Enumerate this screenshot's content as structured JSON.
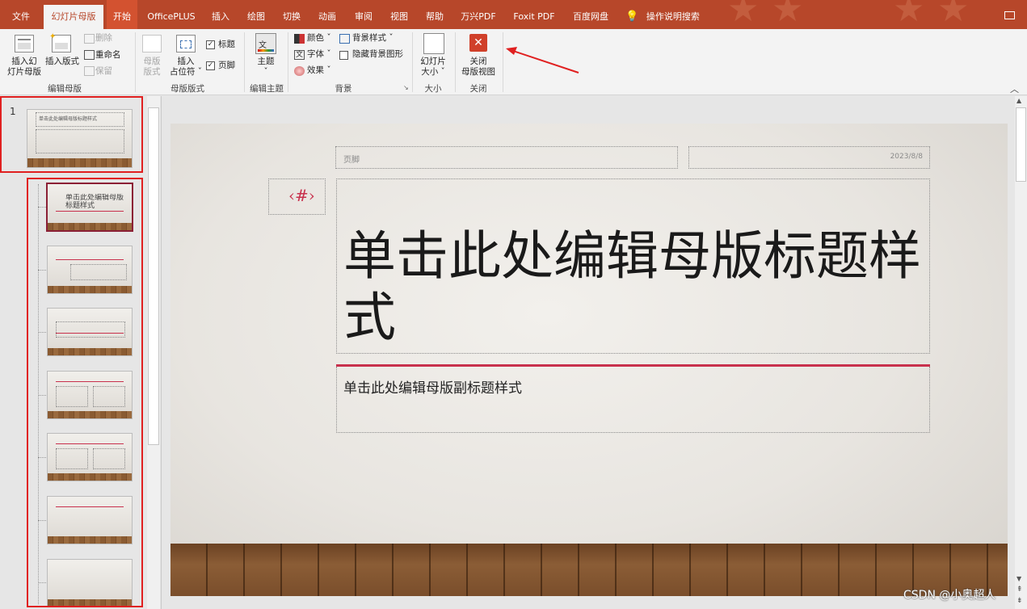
{
  "tabs": [
    {
      "label": "文件"
    },
    {
      "label": "幻灯片母版"
    },
    {
      "label": "开始"
    },
    {
      "label": "OfficePLUS"
    },
    {
      "label": "插入"
    },
    {
      "label": "绘图"
    },
    {
      "label": "切换"
    },
    {
      "label": "动画"
    },
    {
      "label": "审阅"
    },
    {
      "label": "视图"
    },
    {
      "label": "帮助"
    },
    {
      "label": "万兴PDF"
    },
    {
      "label": "Foxit PDF"
    },
    {
      "label": "百度网盘"
    }
  ],
  "tell_me": "操作说明搜索",
  "ribbon": {
    "edit_master": {
      "insert_slide_master": "插入幻\n灯片母版",
      "insert_layout": "插入版式",
      "delete": "删除",
      "rename": "重命名",
      "preserve": "保留",
      "group": "编辑母版"
    },
    "master_layout": {
      "master_layout_btn": "母版\n版式",
      "insert_placeholder": "插入\n占位符 ˇ",
      "title": "标题",
      "footer": "页脚",
      "group": "母版版式"
    },
    "edit_theme": {
      "themes": "主题",
      "group": "编辑主题"
    },
    "background": {
      "colors": "颜色 ˇ",
      "fonts": "字体 ˇ",
      "effects": "效果 ˇ",
      "bg_styles": "背景样式 ˇ",
      "hide_bg": "隐藏背景图形",
      "group": "背景"
    },
    "size": {
      "slide_size": "幻灯片\n大小 ˇ",
      "group": "大小"
    },
    "close": {
      "close_master": "关闭\n母版视图",
      "group": "关闭"
    }
  },
  "thumbs": {
    "master_number": "1",
    "master_title": "单击此处编辑母版标题样式",
    "layout1_title": "单击此处编辑母版标题样式"
  },
  "slide": {
    "footer": "页脚",
    "date": "2023/8/8",
    "slide_number": "‹#›",
    "title": "单击此处编辑母版标题样式",
    "subtitle": "单击此处编辑母版副标题样式"
  },
  "watermark": "CSDN @小奥超人",
  "colors": {
    "tab_bg": "#b7472a",
    "accent": "#c8314d",
    "annotation": "#e02020"
  }
}
